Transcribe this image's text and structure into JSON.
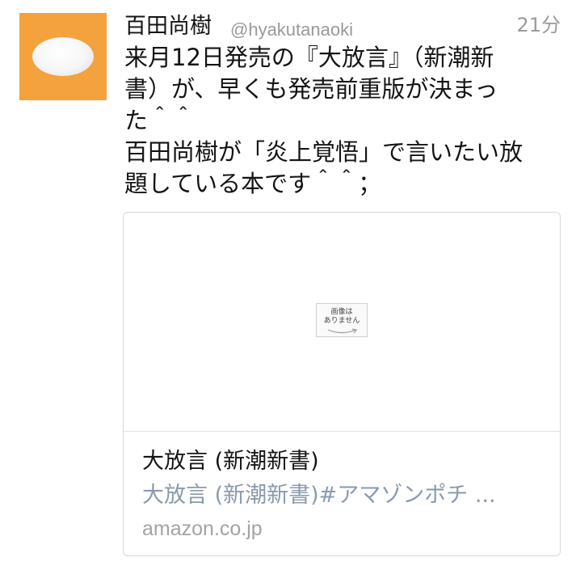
{
  "tweet": {
    "display_name": "百田尚樹",
    "handle": "@hyakutanaoki",
    "time": "21分",
    "text_lines": [
      "来月12日発売の『大放言』（新潮新",
      "書）が、早くも発売前重版が決まっ",
      "た＾＾",
      "百田尚樹が「炎上覚悟」で言いたい放",
      "題している本です＾＾；"
    ]
  },
  "card": {
    "placeholder_text_1": "画像は",
    "placeholder_text_2": "ありません",
    "title": "大放言 (新潮新書)",
    "description": "大放言 (新潮新書)#アマゾンポチ ...",
    "domain": "amazon.co.jp"
  },
  "colors": {
    "avatar_bg": "#f4a23d",
    "secondary_text": "#9a9a9a",
    "link_text": "#8a9aae"
  },
  "icons": {
    "avatar": "default-egg-avatar-icon",
    "no_image": "amazon-no-image-icon"
  }
}
